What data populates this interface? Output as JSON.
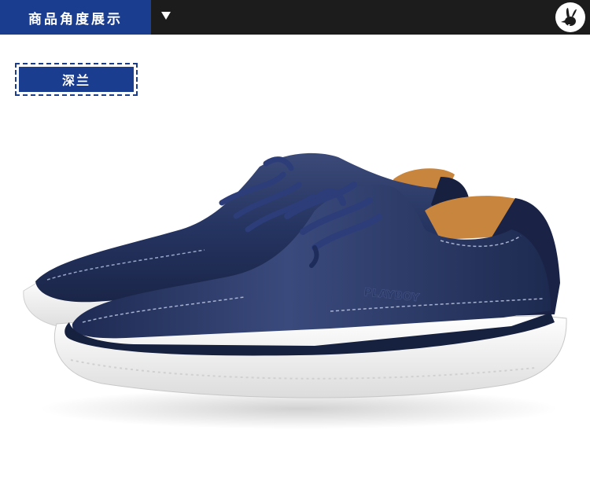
{
  "header": {
    "tab_label": "商品角度展示",
    "dropdown_icon": "triangle-down-icon",
    "logo_icon": "bunny-logo-icon"
  },
  "color_label": "深兰",
  "product": {
    "image": "navy-leather-sneakers-pair",
    "embossed_brand": "PLAYBOY"
  },
  "colors": {
    "accent": "#1a3d8f",
    "header_bg": "#1c1c1c",
    "shoe_navy": "#1f2a4d",
    "sole_white": "#f4f4f4",
    "lining_tan": "#c8853e"
  }
}
